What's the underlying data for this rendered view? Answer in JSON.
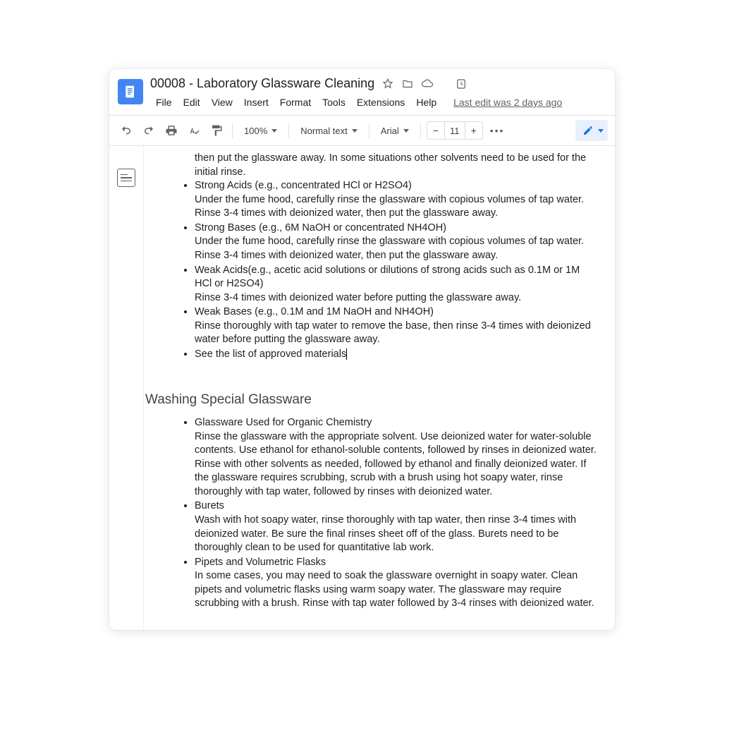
{
  "header": {
    "title": "00008 - Laboratory Glassware Cleaning",
    "last_edit": "Last edit was 2 days ago"
  },
  "menu": {
    "file": "File",
    "edit": "Edit",
    "view": "View",
    "insert": "Insert",
    "format": "Format",
    "tools": "Tools",
    "extensions": "Extensions",
    "help": "Help"
  },
  "toolbar": {
    "zoom": "100%",
    "style": "Normal text",
    "font": "Arial",
    "font_size": "11"
  },
  "doc": {
    "intro": "then put the glassware away. In some situations other solvents need to be used for the initial rinse.",
    "bullets1": [
      {
        "title": "Strong Acids (e.g., concentrated HCl or H2SO4)",
        "body": "Under the fume hood, carefully rinse the glassware with copious volumes of tap water. Rinse 3-4 times with deionized water, then put the glassware away."
      },
      {
        "title": "Strong Bases (e.g., 6M NaOH or concentrated NH4OH)",
        "body": "Under the fume hood, carefully rinse the glassware with copious volumes of tap water. Rinse 3-4 times with deionized water, then put the glassware away."
      },
      {
        "title": "Weak Acids(e.g., acetic acid solutions or dilutions of strong acids such as 0.1M or 1M HCl or H2SO4)",
        "body": "Rinse 3-4 times with deionized water before putting the glassware away."
      },
      {
        "title": "Weak Bases (e.g., 0.1M and 1M NaOH and NH4OH)",
        "body": "Rinse thoroughly with tap water to remove the base, then rinse 3-4 times with deionized water before putting the glassware away."
      },
      {
        "title": "See the list of approved materials",
        "body": ""
      }
    ],
    "heading2": "Washing Special Glassware",
    "bullets2": [
      {
        "title": "Glassware Used for Organic Chemistry",
        "body": "Rinse the glassware with the appropriate solvent. Use deionized water for water-soluble contents. Use ethanol for ethanol-soluble contents, followed by rinses in deionized water. Rinse with other solvents as needed, followed by ethanol and finally deionized water. If the glassware requires scrubbing, scrub with a brush using hot soapy water, rinse thoroughly with tap water, followed by rinses with deionized water."
      },
      {
        "title": "Burets",
        "body": "Wash with hot soapy water, rinse thoroughly with tap water, then rinse 3-4 times with deionized water. Be sure the final rinses sheet off of the glass. Burets need to be thoroughly clean to be used for quantitative lab work."
      },
      {
        "title": "Pipets and Volumetric Flasks",
        "body": "In some cases, you may need to soak the glassware overnight in soapy water. Clean pipets and volumetric flasks using warm soapy water. The glassware may require scrubbing with a brush. Rinse with tap water followed by 3-4 rinses with deionized water."
      }
    ]
  }
}
